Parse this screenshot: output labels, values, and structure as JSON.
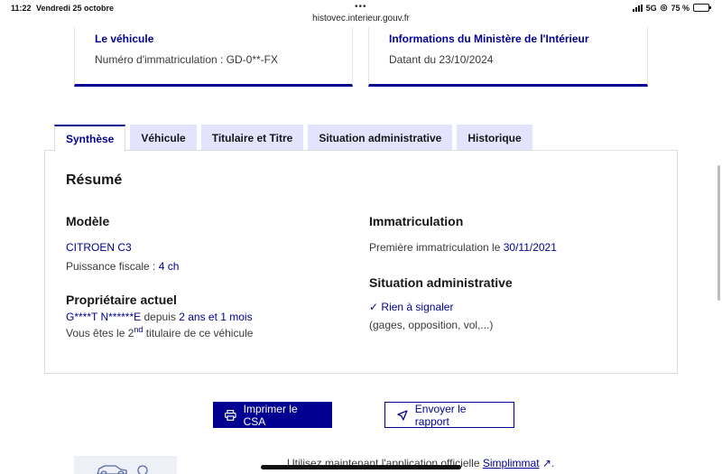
{
  "status_bar": {
    "time": "11:22",
    "date": "Vendredi 25 octobre",
    "network": "5G",
    "battery": "75 %",
    "battery_level": 0.75
  },
  "browser": {
    "url": "histovec.interieur.gouv.fr"
  },
  "cards": {
    "vehicle": {
      "title": "Le véhicule",
      "text": "Numéro d'immatriculation : GD-0**-FX"
    },
    "ministry": {
      "title": "Informations du Ministère de l'Intérieur",
      "text": "Datant du 23/10/2024"
    }
  },
  "tabs": [
    {
      "label": "Synthèse",
      "active": true
    },
    {
      "label": "Véhicule",
      "active": false
    },
    {
      "label": "Titulaire et Titre",
      "active": false
    },
    {
      "label": "Situation administrative",
      "active": false
    },
    {
      "label": "Historique",
      "active": false
    }
  ],
  "summary": {
    "title": "Résumé",
    "model": {
      "heading": "Modèle",
      "name": "CITROEN C3",
      "power_label": "Puissance fiscale :",
      "power_value": "4 ch"
    },
    "owner": {
      "heading": "Propriétaire actuel",
      "name": "G****T N******E",
      "since_label": "depuis",
      "since_value": "2 ans et 1 mois",
      "rank_prefix": "Vous êtes le 2",
      "rank_sup": "nd",
      "rank_suffix": "titulaire de ce véhicule"
    },
    "registration": {
      "heading": "Immatriculation",
      "first_label": "Première immatriculation le",
      "first_date": "30/11/2021"
    },
    "admin": {
      "heading": "Situation administrative",
      "status": "Rien à signaler",
      "details": "(gages, opposition, vol,...)"
    }
  },
  "buttons": {
    "print": "Imprimer le CSA",
    "send": "Envoyer le rapport"
  },
  "footer": {
    "text": "Utilisez maintenant l'application officielle",
    "link": "Simplimmat",
    "end": "."
  }
}
